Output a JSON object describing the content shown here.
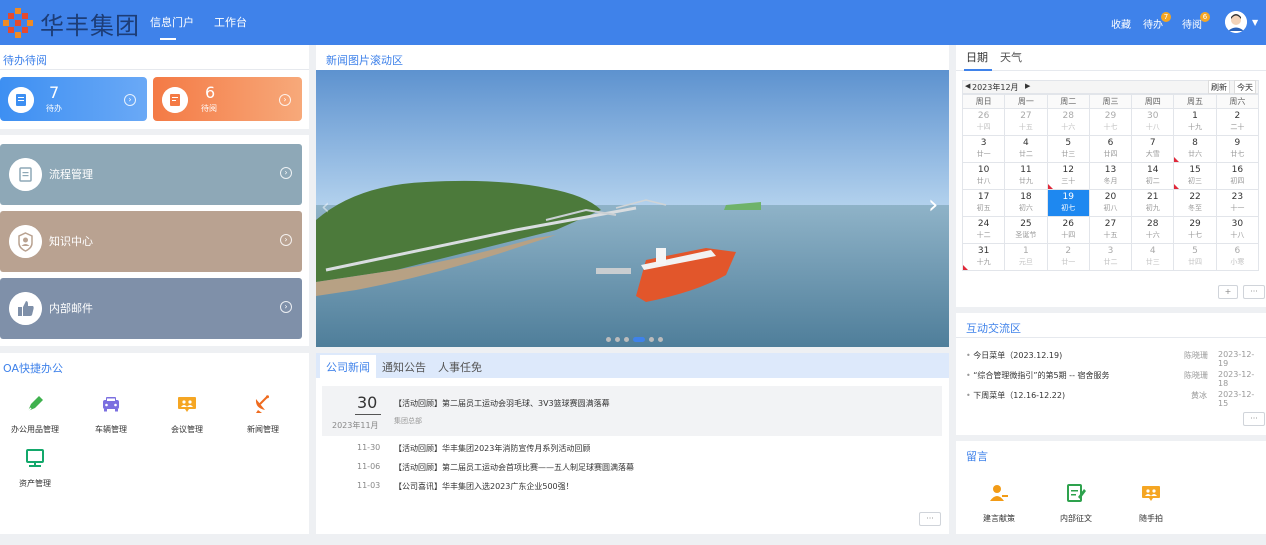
{
  "header": {
    "brand": "华丰集团",
    "nav_tabs": [
      {
        "label": "信息门户",
        "active": true
      },
      {
        "label": "工作台",
        "active": false
      }
    ],
    "favorites_label": "收藏",
    "todo_label": "待办",
    "todo_badge": "7",
    "toread_label": "待阅",
    "toread_badge": "6",
    "accent_color": "#3f82ea"
  },
  "todo_panel": {
    "title": "待办待阅",
    "todo_card": {
      "count": "7",
      "label": "待办"
    },
    "read_card": {
      "count": "6",
      "label": "待阅"
    }
  },
  "modules": [
    {
      "label": "流程管理",
      "icon": "document-icon"
    },
    {
      "label": "知识中心",
      "icon": "user-badge-icon"
    },
    {
      "label": "内部邮件",
      "icon": "thumbs-up-icon"
    }
  ],
  "quick_office": {
    "title": "OA快捷办公",
    "items": [
      {
        "label": "办公用品管理",
        "icon": "pen-icon"
      },
      {
        "label": "车辆管理",
        "icon": "car-icon"
      },
      {
        "label": "会议管理",
        "icon": "meeting-icon"
      },
      {
        "label": "新闻管理",
        "icon": "satellite-dish-icon"
      },
      {
        "label": "资产管理",
        "icon": "monitor-icon"
      }
    ]
  },
  "slider": {
    "title": "新闻图片滚动区",
    "slide_count": 6,
    "active_index": 3
  },
  "news": {
    "tabs": [
      "公司新闻",
      "通知公告",
      "人事任免"
    ],
    "featured": {
      "day": "30",
      "month": "2023年11月",
      "title": "【活动回顾】第二届员工运动会羽毛球、3V3篮球赛圆满落幕",
      "source": "集团总部"
    },
    "items": [
      {
        "date": "11-30",
        "title": "【活动回顾】华丰集团2023年消防宣传月系列活动回顾"
      },
      {
        "date": "11-06",
        "title": "【活动回顾】第二届员工运动会首项比赛——五人制足球赛圆满落幕"
      },
      {
        "date": "11-03",
        "title": "【公司喜讯】华丰集团入选2023广东企业500强！"
      }
    ],
    "more_label": "···"
  },
  "calendar": {
    "tabs": [
      "日期",
      "天气"
    ],
    "month_label": "2023年12月",
    "refresh_label": "刷新",
    "today_label": "今天",
    "weekdays": [
      "周日",
      "周一",
      "周二",
      "周三",
      "周四",
      "周五",
      "周六"
    ],
    "weeks": [
      [
        [
          "26",
          "十四",
          1,
          0
        ],
        [
          "27",
          "十五",
          1,
          0
        ],
        [
          "28",
          "十六",
          1,
          0
        ],
        [
          "29",
          "十七",
          1,
          0
        ],
        [
          "30",
          "十八",
          1,
          0
        ],
        [
          "1",
          "十九",
          0,
          0
        ],
        [
          "2",
          "二十",
          0,
          0
        ]
      ],
      [
        [
          "3",
          "廿一",
          0,
          0
        ],
        [
          "4",
          "廿二",
          0,
          0
        ],
        [
          "5",
          "廿三",
          0,
          0
        ],
        [
          "6",
          "廿四",
          0,
          0
        ],
        [
          "7",
          "大雪",
          0,
          0
        ],
        [
          "8",
          "廿六",
          0,
          1
        ],
        [
          "9",
          "廿七",
          0,
          0
        ]
      ],
      [
        [
          "10",
          "廿八",
          0,
          0
        ],
        [
          "11",
          "廿九",
          0,
          0
        ],
        [
          "12",
          "三十",
          0,
          1
        ],
        [
          "13",
          "冬月",
          0,
          0
        ],
        [
          "14",
          "初二",
          0,
          0
        ],
        [
          "15",
          "初三",
          0,
          1
        ],
        [
          "16",
          "初四",
          0,
          0
        ]
      ],
      [
        [
          "17",
          "初五",
          0,
          0
        ],
        [
          "18",
          "初六",
          0,
          0
        ],
        [
          "19",
          "初七",
          0,
          0
        ],
        [
          "20",
          "初八",
          0,
          0
        ],
        [
          "21",
          "初九",
          0,
          0
        ],
        [
          "22",
          "冬至",
          0,
          0
        ],
        [
          "23",
          "十一",
          0,
          0
        ]
      ],
      [
        [
          "24",
          "十二",
          0,
          0
        ],
        [
          "25",
          "圣诞节",
          0,
          0
        ],
        [
          "26",
          "十四",
          0,
          0
        ],
        [
          "27",
          "十五",
          0,
          0
        ],
        [
          "28",
          "十六",
          0,
          0
        ],
        [
          "29",
          "十七",
          0,
          0
        ],
        [
          "30",
          "十八",
          0,
          0
        ]
      ],
      [
        [
          "31",
          "十九",
          0,
          1
        ],
        [
          "1",
          "元旦",
          1,
          0
        ],
        [
          "2",
          "廿一",
          1,
          0
        ],
        [
          "3",
          "廿二",
          1,
          0
        ],
        [
          "4",
          "廿三",
          1,
          0
        ],
        [
          "5",
          "廿四",
          1,
          0
        ],
        [
          "6",
          "小寒",
          1,
          0
        ]
      ]
    ],
    "selected_day": "19",
    "add_label": "+",
    "more_label": "···"
  },
  "interact": {
    "title": "互动交流区",
    "items": [
      {
        "title": "今日菜单（2023.12.19)",
        "author": "陈晓珊",
        "date": "2023-12-19"
      },
      {
        "title": "“综合管理微指引”的第5期 -- 宿舍服务",
        "author": "陈晓珊",
        "date": "2023-12-18"
      },
      {
        "title": "下周菜单（12.16-12.22)",
        "author": "黄冰",
        "date": "2023-12-15"
      }
    ],
    "more_label": "···"
  },
  "message": {
    "title": "留言",
    "items": [
      {
        "label": "建言献策",
        "icon": "person-key-icon"
      },
      {
        "label": "内部征文",
        "icon": "edit-doc-icon"
      },
      {
        "label": "随手拍",
        "icon": "camera-icon"
      }
    ]
  }
}
